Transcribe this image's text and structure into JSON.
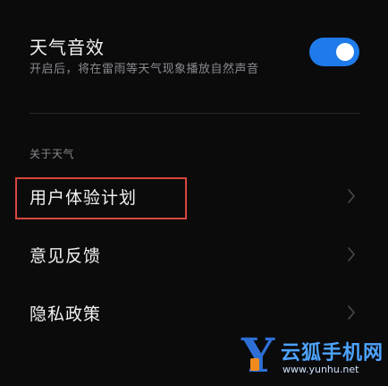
{
  "weather_sound": {
    "title": "天气音效",
    "description": "开启后，将在雷雨等天气现象播放自然声音",
    "enabled": true,
    "toggle_color": "#1f7bea"
  },
  "about_section": {
    "header": "关于天气",
    "items": [
      {
        "label": "用户体验计划",
        "icon": "chevron-right-icon"
      },
      {
        "label": "意见反馈",
        "icon": "chevron-right-icon"
      },
      {
        "label": "隐私政策",
        "icon": "chevron-right-icon"
      }
    ]
  },
  "highlight_color": "#d9463d",
  "watermark": {
    "logo": "Y",
    "name": "云狐手机网",
    "url": "www.yunhu.net"
  }
}
